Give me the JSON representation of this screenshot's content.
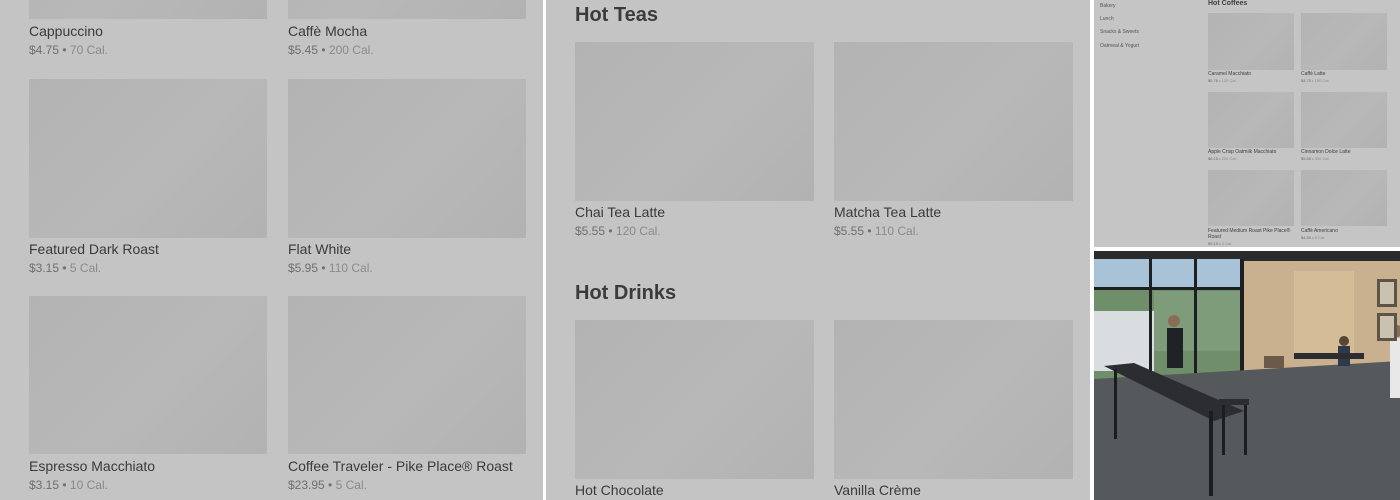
{
  "left_panel": {
    "items": [
      {
        "name": "Cappuccino",
        "price": "$4.75",
        "calories": "70 Cal."
      },
      {
        "name": "Caffè Mocha",
        "price": "$5.45",
        "calories": "200 Cal."
      },
      {
        "name": "Featured Dark Roast",
        "price": "$3.15",
        "calories": "5 Cal."
      },
      {
        "name": "Flat White",
        "price": "$5.95",
        "calories": "110 Cal."
      },
      {
        "name": "Espresso Macchiato",
        "price": "$3.15",
        "calories": "10 Cal."
      },
      {
        "name": "Coffee Traveler - Pike Place® Roast",
        "price": "$23.95",
        "calories": "5 Cal."
      }
    ]
  },
  "middle_panel": {
    "sections": [
      {
        "title": "Hot Teas",
        "items": [
          {
            "name": "Chai Tea Latte",
            "price": "$5.55",
            "calories": "120 Cal."
          },
          {
            "name": "Matcha Tea Latte",
            "price": "$5.55",
            "calories": "110 Cal."
          }
        ]
      },
      {
        "title": "Hot Drinks",
        "items": [
          {
            "name": "Hot Chocolate",
            "price": "",
            "calories": ""
          },
          {
            "name": "Vanilla Crème",
            "price": "",
            "calories": ""
          }
        ]
      }
    ]
  },
  "mini_panel": {
    "nav": [
      "Bakery",
      "Lunch",
      "Snacks & Sweets",
      "Oatmeal & Yogurt"
    ],
    "section_title": "Hot Coffees",
    "items": [
      {
        "name": "Caramel Macchiato",
        "price": "$5.75",
        "calories": "120 Cal."
      },
      {
        "name": "Caffè Latte",
        "price": "$4.75",
        "calories": "190 Cal."
      },
      {
        "name": "Apple Crisp Oatmilk Macchiato",
        "price": "$6.15",
        "calories": "200 Cal."
      },
      {
        "name": "Cinnamon Dolce Latte",
        "price": "$5.95",
        "calories": "330 Cal."
      },
      {
        "name": "Featured Medium Roast Pike Place® Roast",
        "price": "$3.15",
        "calories": "5 Cal."
      },
      {
        "name": "Caffè Americano",
        "price": "$4.35",
        "calories": "5 Cal."
      }
    ]
  },
  "photo": {
    "colors": {
      "floor": "#55595b",
      "wall": "#c9b18f",
      "window": "#6e8f6a",
      "table": "#2b2d30"
    }
  },
  "separator": "•"
}
